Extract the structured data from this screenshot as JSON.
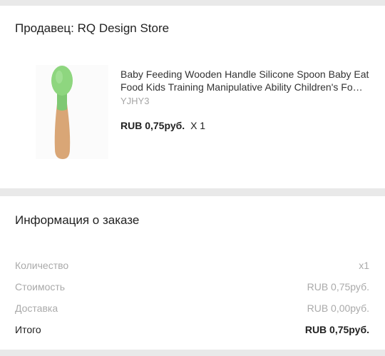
{
  "seller": {
    "label": "Продавец: RQ Design Store"
  },
  "product": {
    "title": "Baby Feeding Wooden Handle Silicone Spoon Baby Eat Food Kids Training Manipulative Ability Children's Fo…",
    "sku": "YJHY3",
    "price": "RUB 0,75руб.",
    "quantity": "X 1",
    "image_icon": "wooden-spoon-green-silicone"
  },
  "order_info": {
    "title": "Информация о заказе",
    "rows": [
      {
        "label": "Количество",
        "value": "x1"
      },
      {
        "label": "Стоимость",
        "value": "RUB 0,75руб."
      },
      {
        "label": "Доставка",
        "value": "RUB 0,00руб."
      },
      {
        "label": "Итого",
        "value": "RUB 0,75руб."
      }
    ]
  },
  "colors": {
    "background": "#e9e9e9",
    "card": "#ffffff",
    "spoon_head": "#8ed67f",
    "spoon_handle": "#d9a676",
    "muted_text": "#aaaaaa",
    "primary_text": "#222222"
  }
}
